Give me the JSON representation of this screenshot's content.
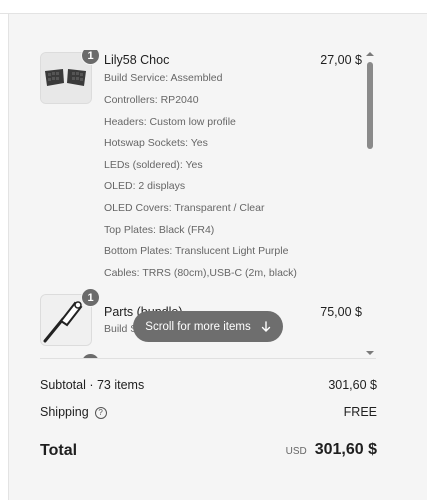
{
  "items": [
    {
      "quantity": "1",
      "title": "Lily58 Choc",
      "price": "27,00 $",
      "properties": [
        "Build Service: Assembled",
        "Controllers: RP2040",
        "Headers: Custom low profile",
        "Hotswap Sockets: Yes",
        "LEDs (soldered): Yes",
        "OLED: 2 displays",
        "OLED Covers: Transparent / Clear",
        "Top Plates: Black (FR4)",
        "Bottom Plates: Translucent Light Purple",
        "Cables: TRRS (80cm),USB-C (2m, black)"
      ]
    },
    {
      "quantity": "1",
      "title": "Parts (bundle)",
      "price": "75,00 $",
      "properties": [
        "Build Service"
      ]
    }
  ],
  "scroll_hint": {
    "label": "Scroll for more items",
    "icon": "arrow-down-icon"
  },
  "summary": {
    "subtotal_label": "Subtotal · 73 items",
    "subtotal_value": "301,60 $",
    "shipping_label": "Shipping",
    "shipping_value": "FREE",
    "help_icon": "?",
    "total_label": "Total",
    "currency": "USD",
    "total_value": "301,60 $"
  }
}
